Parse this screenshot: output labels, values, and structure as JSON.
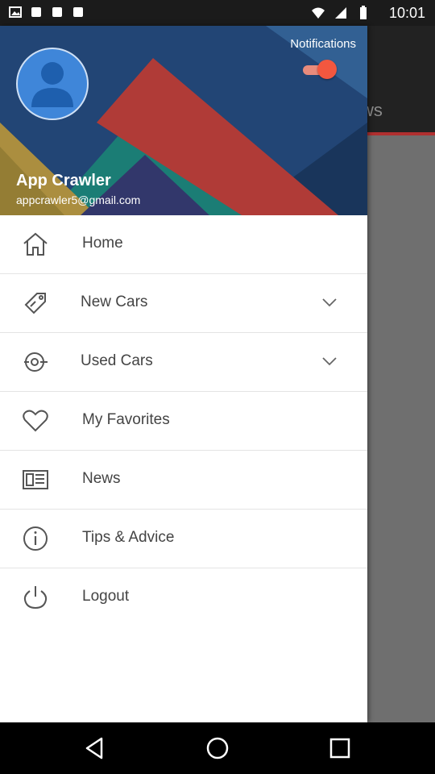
{
  "status_bar": {
    "time": "10:01"
  },
  "background": {
    "tab_fragment": "ws"
  },
  "drawer": {
    "header": {
      "notifications_label": "Notifications",
      "notifications_enabled": true,
      "user_name": "App Crawler",
      "user_email": "appcrawler5@gmail.com"
    },
    "menu": [
      {
        "label": "Home",
        "icon": "home-icon"
      },
      {
        "label": "New Cars",
        "icon": "tag-icon",
        "expandable": true
      },
      {
        "label": "Used Cars",
        "icon": "car-key-icon",
        "expandable": true
      },
      {
        "label": "My Favorites",
        "icon": "heart-icon"
      },
      {
        "label": "News",
        "icon": "newspaper-icon"
      },
      {
        "label": "Tips & Advice",
        "icon": "info-icon"
      },
      {
        "label": "Logout",
        "icon": "power-icon"
      }
    ]
  },
  "colors": {
    "accent": "#f2573f",
    "avatar": "#3f86d9",
    "scrim": "#6f6f6f",
    "header_line": "#b03030"
  }
}
